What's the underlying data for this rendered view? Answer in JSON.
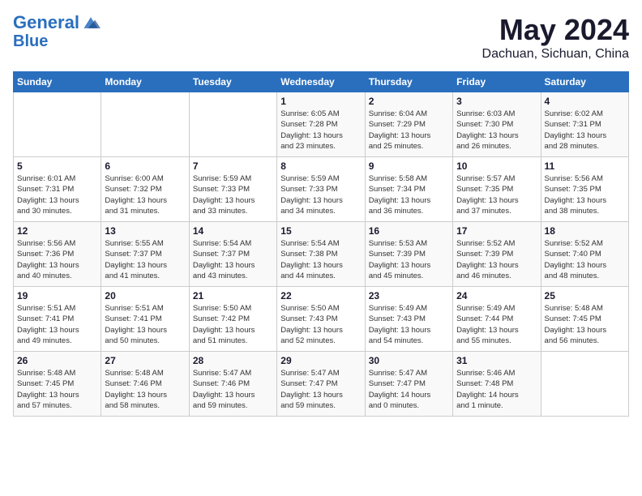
{
  "header": {
    "logo_line1": "General",
    "logo_line2": "Blue",
    "title": "May 2024",
    "subtitle": "Dachuan, Sichuan, China"
  },
  "days_of_week": [
    "Sunday",
    "Monday",
    "Tuesday",
    "Wednesday",
    "Thursday",
    "Friday",
    "Saturday"
  ],
  "weeks": [
    [
      {
        "num": "",
        "info": ""
      },
      {
        "num": "",
        "info": ""
      },
      {
        "num": "",
        "info": ""
      },
      {
        "num": "1",
        "info": "Sunrise: 6:05 AM\nSunset: 7:28 PM\nDaylight: 13 hours\nand 23 minutes."
      },
      {
        "num": "2",
        "info": "Sunrise: 6:04 AM\nSunset: 7:29 PM\nDaylight: 13 hours\nand 25 minutes."
      },
      {
        "num": "3",
        "info": "Sunrise: 6:03 AM\nSunset: 7:30 PM\nDaylight: 13 hours\nand 26 minutes."
      },
      {
        "num": "4",
        "info": "Sunrise: 6:02 AM\nSunset: 7:31 PM\nDaylight: 13 hours\nand 28 minutes."
      }
    ],
    [
      {
        "num": "5",
        "info": "Sunrise: 6:01 AM\nSunset: 7:31 PM\nDaylight: 13 hours\nand 30 minutes."
      },
      {
        "num": "6",
        "info": "Sunrise: 6:00 AM\nSunset: 7:32 PM\nDaylight: 13 hours\nand 31 minutes."
      },
      {
        "num": "7",
        "info": "Sunrise: 5:59 AM\nSunset: 7:33 PM\nDaylight: 13 hours\nand 33 minutes."
      },
      {
        "num": "8",
        "info": "Sunrise: 5:59 AM\nSunset: 7:33 PM\nDaylight: 13 hours\nand 34 minutes."
      },
      {
        "num": "9",
        "info": "Sunrise: 5:58 AM\nSunset: 7:34 PM\nDaylight: 13 hours\nand 36 minutes."
      },
      {
        "num": "10",
        "info": "Sunrise: 5:57 AM\nSunset: 7:35 PM\nDaylight: 13 hours\nand 37 minutes."
      },
      {
        "num": "11",
        "info": "Sunrise: 5:56 AM\nSunset: 7:35 PM\nDaylight: 13 hours\nand 38 minutes."
      }
    ],
    [
      {
        "num": "12",
        "info": "Sunrise: 5:56 AM\nSunset: 7:36 PM\nDaylight: 13 hours\nand 40 minutes."
      },
      {
        "num": "13",
        "info": "Sunrise: 5:55 AM\nSunset: 7:37 PM\nDaylight: 13 hours\nand 41 minutes."
      },
      {
        "num": "14",
        "info": "Sunrise: 5:54 AM\nSunset: 7:37 PM\nDaylight: 13 hours\nand 43 minutes."
      },
      {
        "num": "15",
        "info": "Sunrise: 5:54 AM\nSunset: 7:38 PM\nDaylight: 13 hours\nand 44 minutes."
      },
      {
        "num": "16",
        "info": "Sunrise: 5:53 AM\nSunset: 7:39 PM\nDaylight: 13 hours\nand 45 minutes."
      },
      {
        "num": "17",
        "info": "Sunrise: 5:52 AM\nSunset: 7:39 PM\nDaylight: 13 hours\nand 46 minutes."
      },
      {
        "num": "18",
        "info": "Sunrise: 5:52 AM\nSunset: 7:40 PM\nDaylight: 13 hours\nand 48 minutes."
      }
    ],
    [
      {
        "num": "19",
        "info": "Sunrise: 5:51 AM\nSunset: 7:41 PM\nDaylight: 13 hours\nand 49 minutes."
      },
      {
        "num": "20",
        "info": "Sunrise: 5:51 AM\nSunset: 7:41 PM\nDaylight: 13 hours\nand 50 minutes."
      },
      {
        "num": "21",
        "info": "Sunrise: 5:50 AM\nSunset: 7:42 PM\nDaylight: 13 hours\nand 51 minutes."
      },
      {
        "num": "22",
        "info": "Sunrise: 5:50 AM\nSunset: 7:43 PM\nDaylight: 13 hours\nand 52 minutes."
      },
      {
        "num": "23",
        "info": "Sunrise: 5:49 AM\nSunset: 7:43 PM\nDaylight: 13 hours\nand 54 minutes."
      },
      {
        "num": "24",
        "info": "Sunrise: 5:49 AM\nSunset: 7:44 PM\nDaylight: 13 hours\nand 55 minutes."
      },
      {
        "num": "25",
        "info": "Sunrise: 5:48 AM\nSunset: 7:45 PM\nDaylight: 13 hours\nand 56 minutes."
      }
    ],
    [
      {
        "num": "26",
        "info": "Sunrise: 5:48 AM\nSunset: 7:45 PM\nDaylight: 13 hours\nand 57 minutes."
      },
      {
        "num": "27",
        "info": "Sunrise: 5:48 AM\nSunset: 7:46 PM\nDaylight: 13 hours\nand 58 minutes."
      },
      {
        "num": "28",
        "info": "Sunrise: 5:47 AM\nSunset: 7:46 PM\nDaylight: 13 hours\nand 59 minutes."
      },
      {
        "num": "29",
        "info": "Sunrise: 5:47 AM\nSunset: 7:47 PM\nDaylight: 13 hours\nand 59 minutes."
      },
      {
        "num": "30",
        "info": "Sunrise: 5:47 AM\nSunset: 7:47 PM\nDaylight: 14 hours\nand 0 minutes."
      },
      {
        "num": "31",
        "info": "Sunrise: 5:46 AM\nSunset: 7:48 PM\nDaylight: 14 hours\nand 1 minute."
      },
      {
        "num": "",
        "info": ""
      }
    ]
  ]
}
